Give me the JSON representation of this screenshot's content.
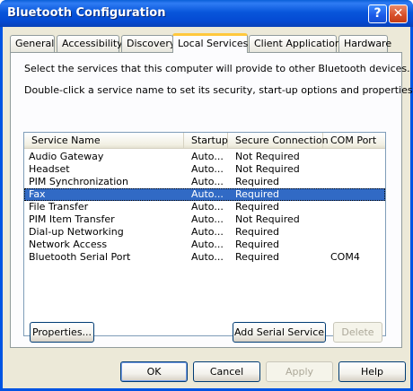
{
  "window": {
    "title": "Bluetooth Configuration",
    "help_glyph": "?",
    "close_glyph": "✕"
  },
  "tabs": [
    {
      "label": "General"
    },
    {
      "label": "Accessibility"
    },
    {
      "label": "Discovery"
    },
    {
      "label": "Local Services"
    },
    {
      "label": "Client Applications"
    },
    {
      "label": "Hardware"
    }
  ],
  "active_tab": "Local Services",
  "panel": {
    "description_1": "Select the services that this computer will provide to other Bluetooth devices.",
    "description_2": "Double-click a service name to set its security, start-up options and properties."
  },
  "list": {
    "columns": [
      "Service Name",
      "Startup",
      "Secure Connection",
      "COM Port"
    ],
    "rows": [
      {
        "name": "Audio Gateway",
        "startup": "Auto...",
        "secure": "Not Required",
        "com": ""
      },
      {
        "name": "Headset",
        "startup": "Auto...",
        "secure": "Not Required",
        "com": ""
      },
      {
        "name": "PIM Synchronization",
        "startup": "Auto...",
        "secure": "Required",
        "com": ""
      },
      {
        "name": "Fax",
        "startup": "Auto...",
        "secure": "Required",
        "com": ""
      },
      {
        "name": "File Transfer",
        "startup": "Auto...",
        "secure": "Required",
        "com": ""
      },
      {
        "name": "PIM Item Transfer",
        "startup": "Auto...",
        "secure": "Not Required",
        "com": ""
      },
      {
        "name": "Dial-up Networking",
        "startup": "Auto...",
        "secure": "Required",
        "com": ""
      },
      {
        "name": "Network Access",
        "startup": "Auto...",
        "secure": "Required",
        "com": ""
      },
      {
        "name": "Bluetooth Serial Port",
        "startup": "Auto...",
        "secure": "Required",
        "com": "COM4"
      }
    ],
    "selected_row": "Fax"
  },
  "panel_buttons": {
    "properties": "Properties...",
    "add_serial": "Add Serial Service",
    "delete": "Delete"
  },
  "dialog_buttons": {
    "ok": "OK",
    "cancel": "Cancel",
    "apply": "Apply",
    "help": "Help"
  },
  "colors": {
    "selection": "#316ac5",
    "titlebar": "#0054e3",
    "face": "#ece9d8"
  }
}
